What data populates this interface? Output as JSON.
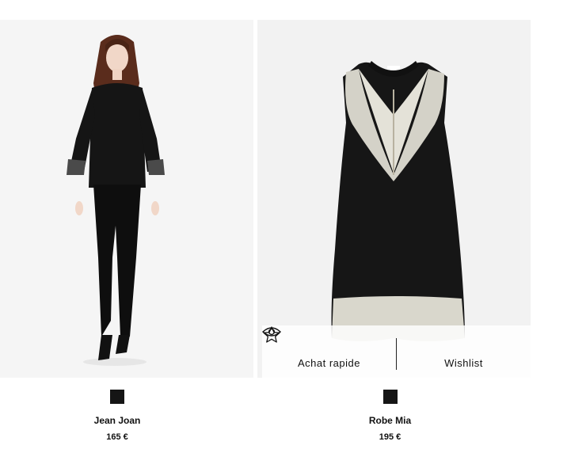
{
  "products": [
    {
      "name": "Jean Joan",
      "price": "165 €",
      "swatch_color": "#151515"
    },
    {
      "name": "Robe Mia",
      "price": "195 €",
      "swatch_color": "#151515"
    }
  ],
  "overlay": {
    "quick_view_label": "Achat rapide",
    "quick_view_icon": "eye-icon",
    "wishlist_label": "Wishlist",
    "wishlist_icon": "star-icon"
  }
}
